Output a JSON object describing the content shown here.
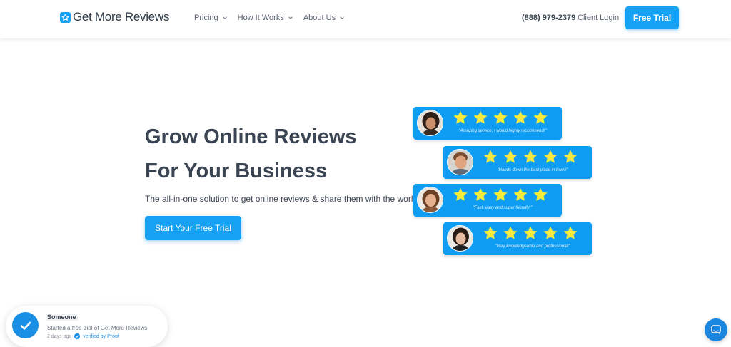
{
  "header": {
    "logo_text": "Get More Reviews",
    "nav": [
      {
        "label": "Pricing"
      },
      {
        "label": "How It Works"
      },
      {
        "label": "About Us"
      }
    ],
    "phone": "(888) 979-2379",
    "client_login": "Client Login",
    "cta_label": "Free Trial"
  },
  "hero": {
    "title_line1": "Grow Online Reviews",
    "title_line2": "For Your Business",
    "subtitle": "The all-in-one solution to get online reviews & share them with the world",
    "cta_label": "Start Your Free Trial"
  },
  "reviews": [
    {
      "stars": 5,
      "quote": "\"Amazing service, I would highly recommend!\""
    },
    {
      "stars": 5,
      "quote": "\"Hands down the best place in town!\""
    },
    {
      "stars": 5,
      "quote": "\"Fast, easy and super friendly!\""
    },
    {
      "stars": 5,
      "quote": "\"Very knowledgeable and professional!\""
    }
  ],
  "proof": {
    "name": "Someone",
    "message": "Started a free trial of Get More Reviews",
    "time": "2 days ago",
    "verified": "verified by Proof"
  },
  "colors": {
    "brand_blue": "#16a1f4",
    "card_blue": "#0f9df3",
    "star_yellow": "#f7ea3e",
    "heading": "#3a4452"
  },
  "icons": {
    "logo": "star-badge-icon",
    "nav_chevron": "chevron-down-icon",
    "review_star": "star-icon",
    "proof": "check-circle-icon",
    "chat": "chat-bubble-icon"
  }
}
